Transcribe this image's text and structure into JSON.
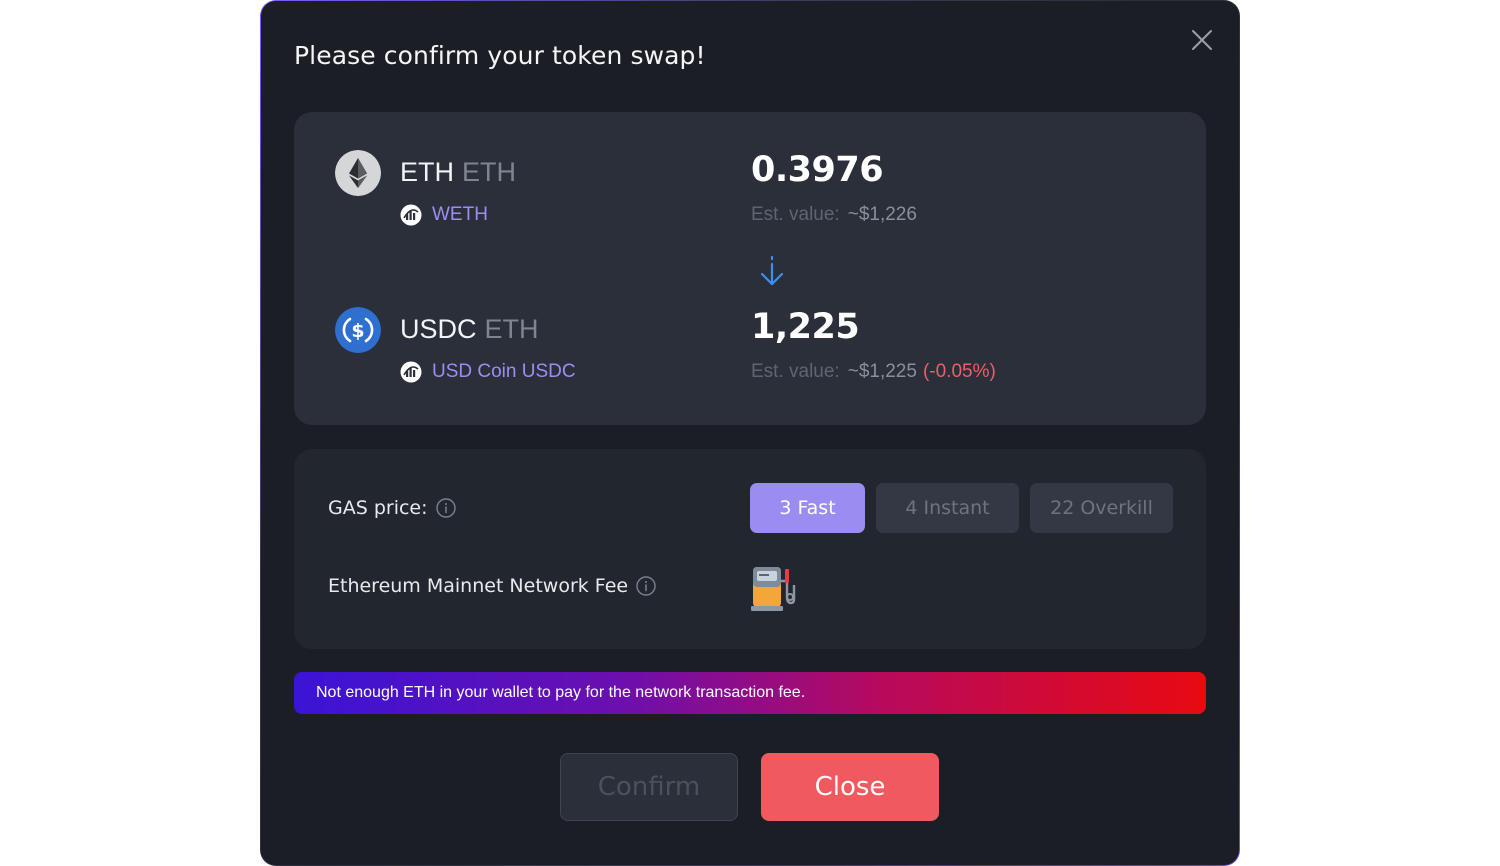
{
  "dialog": {
    "title": "Please confirm your token swap!",
    "close_icon": "close-icon"
  },
  "swap": {
    "from": {
      "symbol": "ETH",
      "chain": "ETH",
      "icon": "ethereum-icon",
      "sub_icon": "wrap-icon",
      "sub_label": "WETH",
      "amount": "0.3976",
      "est_label": "Est. value:",
      "est_value": "~$1,226"
    },
    "direction_icon": "arrow-down-icon",
    "to": {
      "symbol": "USDC",
      "chain": "ETH",
      "icon": "usdc-icon",
      "sub_icon": "wrap-icon",
      "sub_label": "USD Coin USDC",
      "amount": "1,225",
      "est_label": "Est. value:",
      "est_value": "~$1,225",
      "est_change": "(-0.05%)"
    }
  },
  "gas": {
    "label": "GAS price:",
    "options": [
      {
        "label": "3 Fast",
        "selected": true
      },
      {
        "label": "4 Instant",
        "selected": false
      },
      {
        "label": "22 Overkill",
        "selected": false
      }
    ],
    "network_fee_label": "Ethereum Mainnet Network Fee",
    "network_fee_icon": "gas-pump-icon"
  },
  "warning": {
    "text": "Not enough ETH in your wallet to pay for the network transaction fee."
  },
  "actions": {
    "confirm_label": "Confirm",
    "close_label": "Close"
  },
  "colors": {
    "background": "#1b1e25",
    "card": "#2a2f39",
    "accent": "#9b8cf2",
    "danger": "#f0595e",
    "link": "#9d8cf5"
  }
}
